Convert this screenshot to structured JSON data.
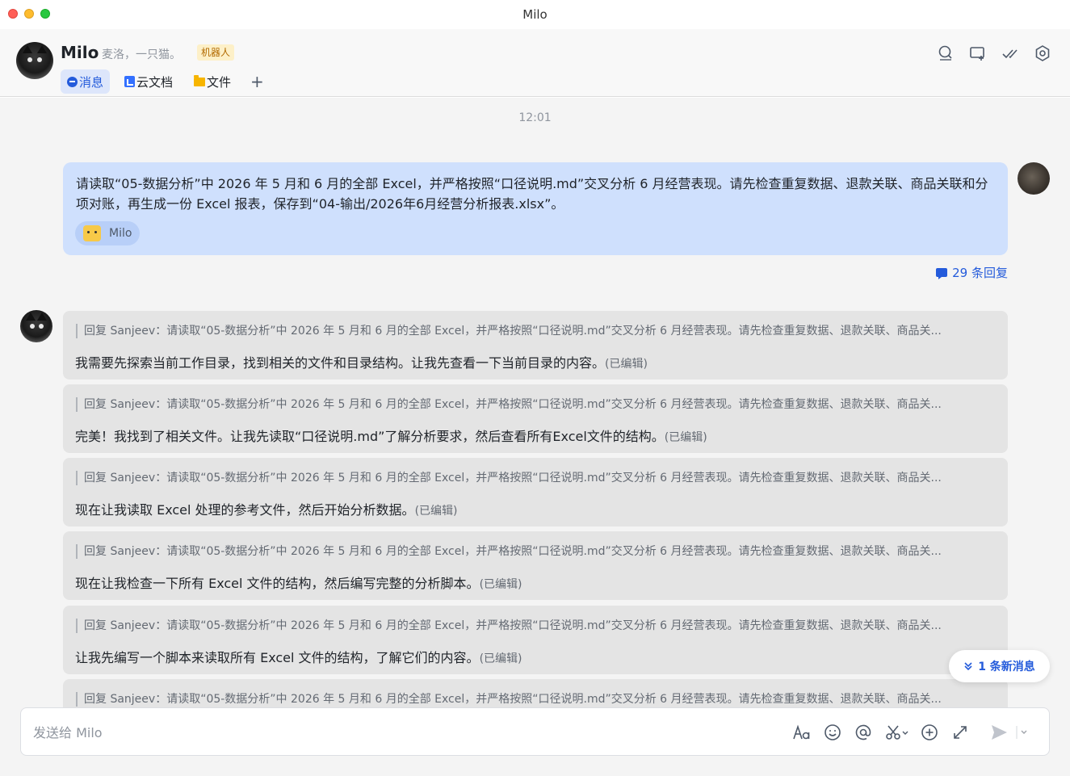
{
  "window": {
    "title": "Milo"
  },
  "header": {
    "name": "Milo",
    "description": "麦洛，一只猫。",
    "badge": "机器人",
    "tabs": [
      {
        "label": "消息",
        "icon": "message-icon",
        "active": true
      },
      {
        "label": "云文档",
        "icon": "doc-icon",
        "active": false
      },
      {
        "label": "文件",
        "icon": "folder-icon",
        "active": false
      }
    ],
    "add_tab": "+"
  },
  "chat": {
    "time": "12:01",
    "my_message": {
      "text": "请读取“05-数据分析”中 2026 年 5 月和 6 月的全部 Excel，并严格按照“口径说明.md”交叉分析 6 月经营表现。请先检查重复数据、退款关联、商品关联和分项对账，再生成一份 Excel 报表，保存到“04-输出/2026年6月经营分析报表.xlsx”。",
      "mention": "Milo"
    },
    "replies_count": "29 条回复",
    "cards": [
      {
        "quote": "回复 Sanjeev：请读取“05-数据分析”中 2026 年 5 月和 6 月的全部 Excel，并严格按照“口径说明.md”交叉分析 6 月经营表现。请先检查重复数据、退款关联、商品关...",
        "text": "我需要先探索当前工作目录，找到相关的文件和目录结构。让我先查看一下当前目录的内容。",
        "edited": "(已编辑)"
      },
      {
        "quote": "回复 Sanjeev：请读取“05-数据分析”中 2026 年 5 月和 6 月的全部 Excel，并严格按照“口径说明.md”交叉分析 6 月经营表现。请先检查重复数据、退款关联、商品关...",
        "text": "完美！我找到了相关文件。让我先读取“口径说明.md”了解分析要求，然后查看所有Excel文件的结构。",
        "edited": "(已编辑)"
      },
      {
        "quote": "回复 Sanjeev：请读取“05-数据分析”中 2026 年 5 月和 6 月的全部 Excel，并严格按照“口径说明.md”交叉分析 6 月经营表现。请先检查重复数据、退款关联、商品关...",
        "text": "现在让我读取 Excel 处理的参考文件，然后开始分析数据。",
        "edited": "(已编辑)"
      },
      {
        "quote": "回复 Sanjeev：请读取“05-数据分析”中 2026 年 5 月和 6 月的全部 Excel，并严格按照“口径说明.md”交叉分析 6 月经营表现。请先检查重复数据、退款关联、商品关...",
        "text": "现在让我检查一下所有 Excel 文件的结构，然后编写完整的分析脚本。",
        "edited": "(已编辑)"
      },
      {
        "quote": "回复 Sanjeev：请读取“05-数据分析”中 2026 年 5 月和 6 月的全部 Excel，并严格按照“口径说明.md”交叉分析 6 月经营表现。请先检查重复数据、退款关联、商品关...",
        "text": "让我先编写一个脚本来读取所有 Excel 文件的结构，了解它们的内容。",
        "edited": "(已编辑)"
      },
      {
        "quote": "回复 Sanjeev：请读取“05-数据分析”中 2026 年 5 月和 6 月的全部 Excel，并严格按照“口径说明.md”交叉分析 6 月经营表现。请先检查重复数据、退款关联、商品关...",
        "text": "",
        "edited": ""
      }
    ],
    "new_messages": "1 条新消息"
  },
  "composer": {
    "placeholder": "发送给 Milo",
    "value": ""
  }
}
